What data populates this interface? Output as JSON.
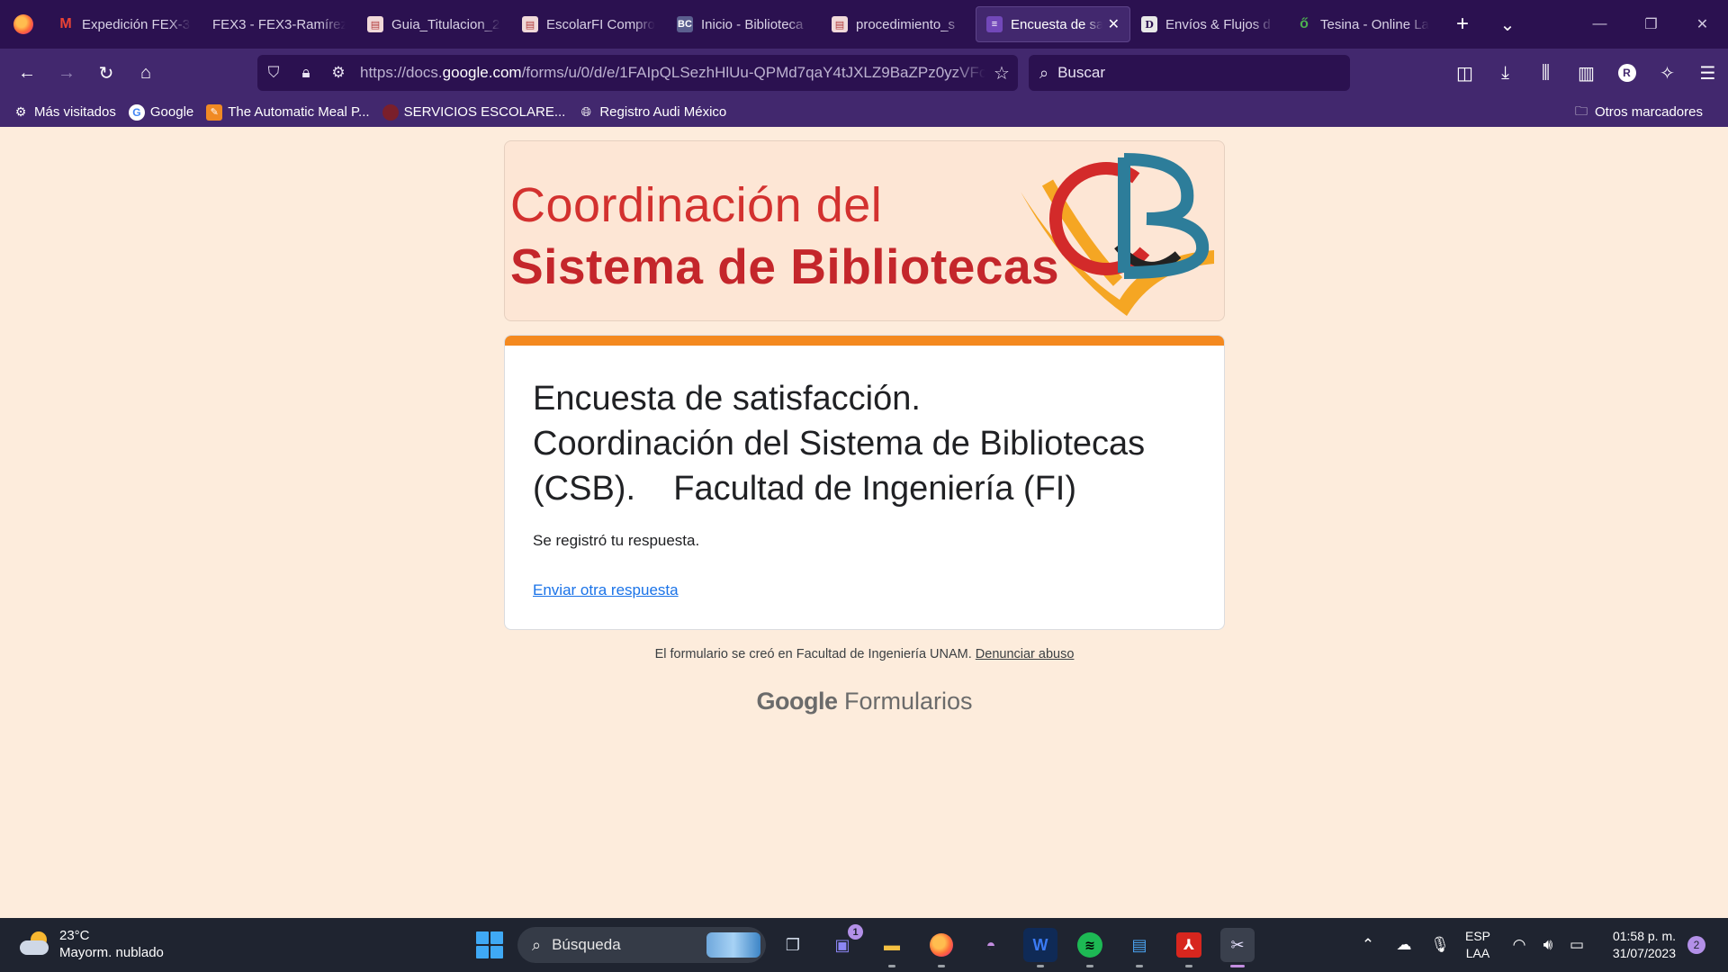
{
  "browser": {
    "tabs": [
      {
        "label": "Expedición FEX-3",
        "favicon": "gmail-icon",
        "color": "#ea4335"
      },
      {
        "label": "FEX3 - FEX3-Ramírez",
        "favicon": "none",
        "color": "#2b1150"
      },
      {
        "label": "Guia_Titulacion_2",
        "favicon": "unam-doc-icon",
        "color": "#b23b3b"
      },
      {
        "label": "EscolarFI Compro",
        "favicon": "unam-doc-icon",
        "color": "#b23b3b"
      },
      {
        "label": "Inicio - Biblioteca",
        "favicon": "bc-icon",
        "color": "#5b5f8f"
      },
      {
        "label": "procedimiento_s",
        "favicon": "unam-doc-icon",
        "color": "#b23b3b"
      },
      {
        "label": "Encuesta de sa",
        "favicon": "google-forms-icon",
        "color": "#7248b9",
        "active": true
      },
      {
        "label": "Envíos & Flujos d",
        "favicon": "d-icon",
        "color": "#e8e8e8"
      },
      {
        "label": "Tesina - Online La",
        "favicon": "overleaf-icon",
        "color": "#3a8f3a"
      }
    ],
    "new_tab_label": "+",
    "tab_list_label": "⌄",
    "url_prefix": "https://docs.",
    "url_domain": "google.com",
    "url_path": "/forms/u/0/d/e/1FAIpQLSezhHlUu-QPMd7qaY4tJXLZ9BaZPz0yzVFc",
    "search_placeholder": "Buscar",
    "bookmarks": [
      {
        "label": "Más visitados",
        "icon": "gear-icon"
      },
      {
        "label": "Google",
        "icon": "google-icon"
      },
      {
        "label": "The Automatic Meal P...",
        "icon": "meal-icon"
      },
      {
        "label": "SERVICIOS ESCOLARE...",
        "icon": "unam-icon"
      },
      {
        "label": "Registro Audi México",
        "icon": "globe-icon"
      }
    ],
    "other_bookmarks": "Otros marcadores",
    "profile_initial": "R"
  },
  "page": {
    "banner_line1": "Coordinación del",
    "banner_line2": "Sistema de Bibliotecas",
    "title": "Encuesta de satisfacción.\nCoordinación del Sistema de Bibliotecas\n(CSB).    Facultad de Ingeniería (FI)",
    "confirmation": "Se registró tu respuesta.",
    "another_response": "Enviar otra respuesta",
    "footer_text": "El formulario se creó en Facultad de Ingeniería UNAM.",
    "footer_abuse": "Denunciar abuso",
    "brand_google": "Google",
    "brand_forms": "Formularios",
    "accent_color": "#f4891f"
  },
  "taskbar": {
    "temperature": "23°C",
    "weather": "Mayorm. nublado",
    "search_label": "Búsqueda",
    "chat_badge": "1",
    "lang_top": "ESP",
    "lang_bottom": "LAA",
    "time": "01:58 p. m.",
    "date": "31/07/2023",
    "notifications": "2"
  }
}
